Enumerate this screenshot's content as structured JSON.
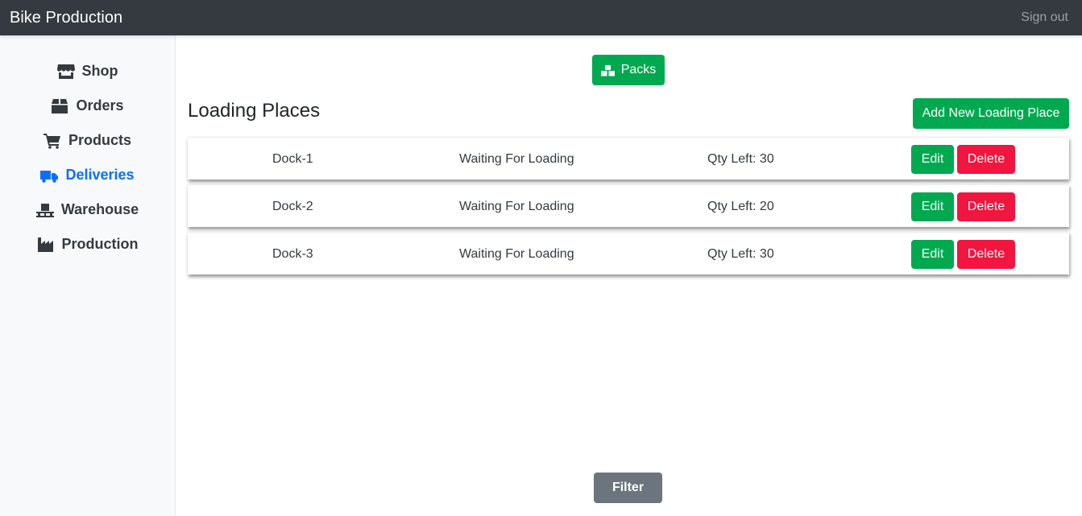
{
  "header": {
    "brand": "Bike Production",
    "signout_label": "Sign out"
  },
  "sidebar": {
    "items": [
      {
        "label": "Shop",
        "icon": "store-icon",
        "active": false
      },
      {
        "label": "Orders",
        "icon": "box-icon",
        "active": false
      },
      {
        "label": "Products",
        "icon": "shopping-cart-icon",
        "active": false
      },
      {
        "label": "Deliveries",
        "icon": "truck-icon",
        "active": true
      },
      {
        "label": "Warehouse",
        "icon": "pallet-icon",
        "active": false
      },
      {
        "label": "Production",
        "icon": "industry-icon",
        "active": false
      }
    ]
  },
  "main": {
    "packs_label": "Packs",
    "packs_icon": "cubes-icon",
    "title": "Loading Places",
    "add_label": "Add New Loading Place",
    "rows": [
      {
        "name": "Dock-1",
        "status": "Waiting For Loading",
        "qty": "Qty Left: 30"
      },
      {
        "name": "Dock-2",
        "status": "Waiting For Loading",
        "qty": "Qty Left: 20"
      },
      {
        "name": "Dock-3",
        "status": "Waiting For Loading",
        "qty": "Qty Left: 30"
      }
    ],
    "edit_label": "Edit",
    "delete_label": "Delete",
    "filter_label": "Filter"
  },
  "colors": {
    "navbar": "#343a40",
    "sidebar_bg": "#f8f9fa",
    "active": "#0d6efd",
    "success": "#00a94f",
    "danger": "#f0163f",
    "secondary": "#6c757d"
  }
}
